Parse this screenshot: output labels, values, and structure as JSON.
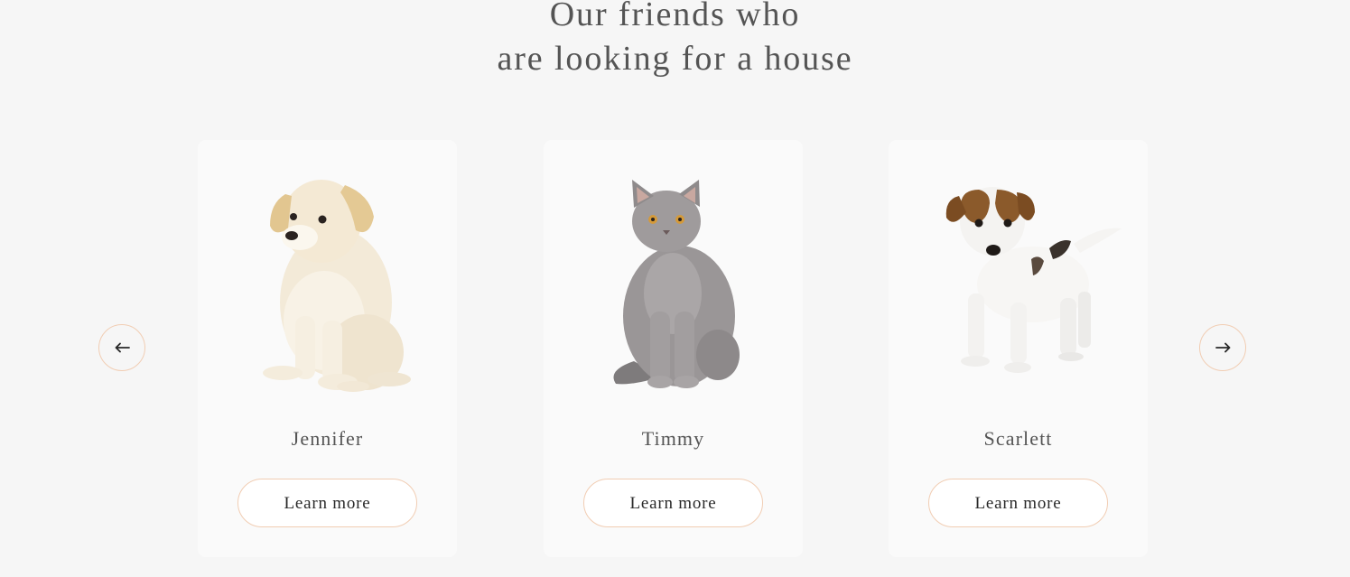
{
  "section": {
    "title_line1": "Our friends who",
    "title_line2": "are looking for a house"
  },
  "pets": [
    {
      "name": "Jennifer",
      "button_label": "Learn more",
      "image_icon": "puppy-photo"
    },
    {
      "name": "Timmy",
      "button_label": "Learn more",
      "image_icon": "cat-photo"
    },
    {
      "name": "Scarlett",
      "button_label": "Learn more",
      "image_icon": "jack-russell-photo"
    }
  ],
  "navigation": {
    "prev_icon": "arrow-left-icon",
    "next_icon": "arrow-right-icon"
  },
  "colors": {
    "background": "#f6f6f6",
    "card": "#fafafa",
    "accent_border": "#f1cdb3",
    "text": "#545454",
    "button_text": "#292929"
  }
}
